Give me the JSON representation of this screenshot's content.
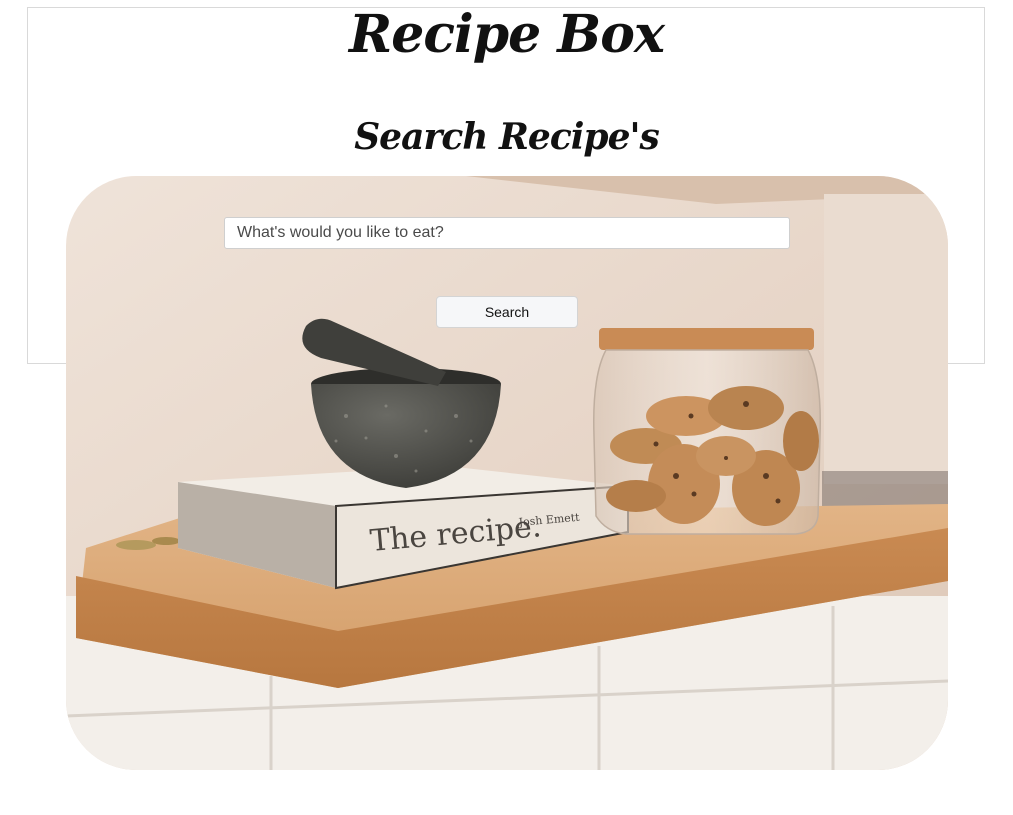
{
  "header": {
    "app_title": "Recipe Box",
    "section_title": "Search Recipe's"
  },
  "search": {
    "placeholder": "What's would you like to eat?",
    "value": "",
    "button_label": "Search"
  },
  "hero": {
    "book_title": "The recipe.",
    "book_author": "Josh Emett"
  },
  "colors": {
    "wall": "#e9dbd0",
    "shelf": "#d79f6a",
    "tile": "#f3efea",
    "jar_lid": "#c98b55",
    "mortar": "#4a4a46"
  }
}
